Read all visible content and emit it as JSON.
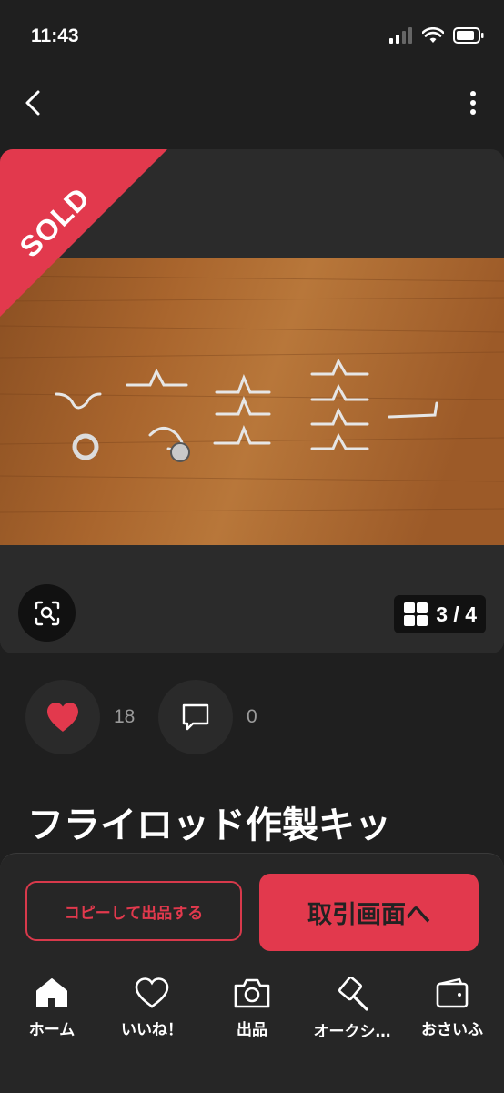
{
  "status": {
    "time": "11:43"
  },
  "media": {
    "sold_label": "SOLD",
    "counter": "3 / 4"
  },
  "actions": {
    "likes": "18",
    "comments": "0"
  },
  "item": {
    "title": "フライロッド作製キッ"
  },
  "sheet": {
    "copy_label": "コピーして出品する",
    "trade_label": "取引画面へ"
  },
  "tabs": [
    {
      "label": "ホーム",
      "icon": "home-icon"
    },
    {
      "label": "いいね！",
      "icon": "heart-outline-icon"
    },
    {
      "label": "出品",
      "icon": "camera-icon"
    },
    {
      "label": "オークシ…",
      "icon": "auction-hammer-icon"
    },
    {
      "label": "おさいふ",
      "icon": "wallet-icon"
    }
  ],
  "colors": {
    "background": "#1f1f1f",
    "accent": "#e2394d",
    "card": "#2b2b2b"
  }
}
